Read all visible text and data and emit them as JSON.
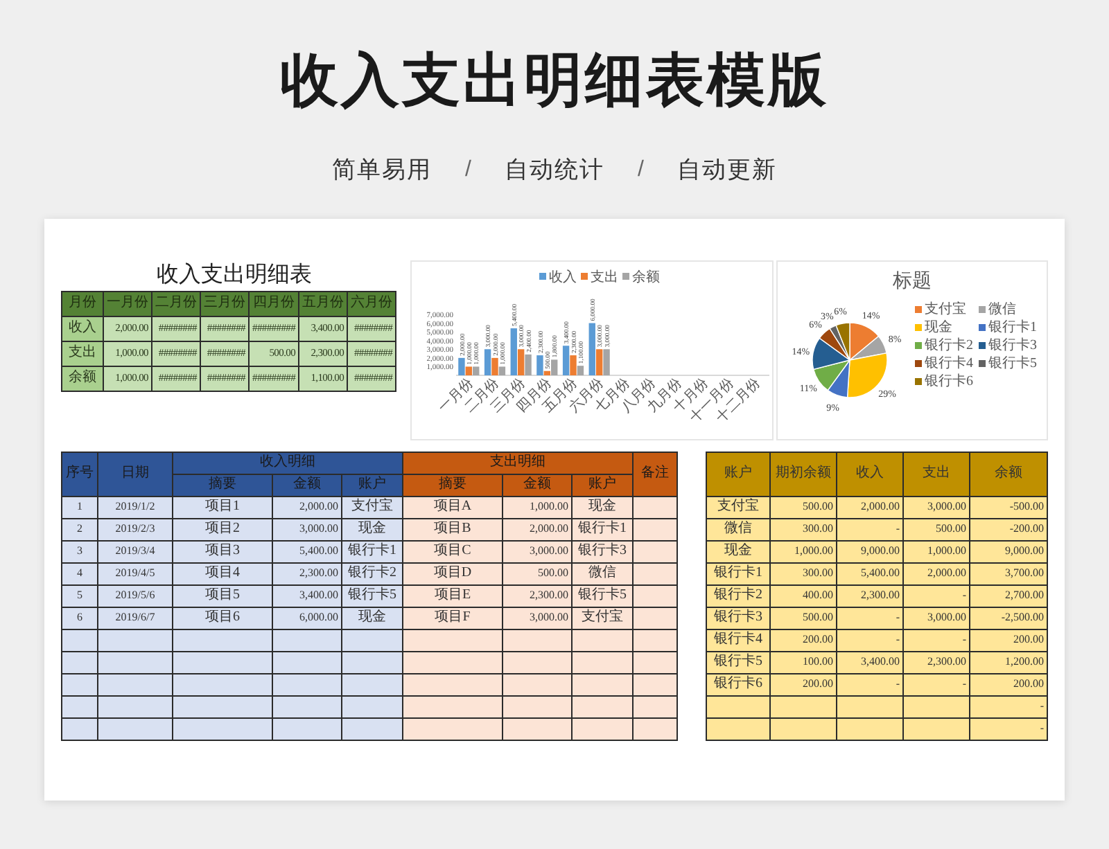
{
  "title": "收入支出明细表模版",
  "subtitle": [
    {
      "kind": "text",
      "text": "简单易用"
    },
    {
      "kind": "separator",
      "text": "/"
    },
    {
      "kind": "text",
      "text": "自动统计"
    },
    {
      "kind": "separator",
      "text": "/"
    },
    {
      "kind": "text",
      "text": "自动更新"
    }
  ],
  "summary": {
    "title": "收入支出明细表",
    "columns": [
      "月份",
      "一月份",
      "二月份",
      "三月份",
      "四月份",
      "五月份",
      "六月份"
    ],
    "rows": [
      [
        "收入",
        "2,000.00",
        "########",
        "########",
        "#########",
        "3,400.00",
        "########"
      ],
      [
        "支出",
        "1,000.00",
        "########",
        "########",
        "500.00",
        "2,300.00",
        "########"
      ],
      [
        "余额",
        "1,000.00",
        "########",
        "########",
        "#########",
        "1,100.00",
        "########"
      ]
    ]
  },
  "bar_chart": {
    "chart_data": {
      "type": "bar",
      "categories": [
        "一月份",
        "二月份",
        "三月份",
        "四月份",
        "五月份",
        "六月份",
        "七月份",
        "八月份",
        "九月份",
        "十月份",
        "十一月份",
        "十二月份"
      ],
      "series": [
        {
          "name": "收入",
          "color": "#5b9bd5",
          "values": [
            2000,
            3000,
            5400,
            2300,
            3400,
            6000,
            null,
            null,
            null,
            null,
            null,
            null
          ]
        },
        {
          "name": "支出",
          "color": "#ed7d31",
          "values": [
            1000,
            2000,
            3000,
            500,
            2300,
            3000,
            null,
            null,
            null,
            null,
            null,
            null
          ]
        },
        {
          "name": "余额",
          "color": "#a5a5a5",
          "values": [
            1000,
            1000,
            2400,
            1800,
            1100,
            3000,
            null,
            null,
            null,
            null,
            null,
            null
          ]
        }
      ],
      "ylim": [
        0,
        7000
      ],
      "yticks": [
        {
          "value": 1000,
          "label": "1,000.00"
        },
        {
          "value": 2000,
          "label": "2,000.00"
        },
        {
          "value": 3000,
          "label": "3,000.00"
        },
        {
          "value": 4000,
          "label": "4,000.00"
        },
        {
          "value": 5000,
          "label": "5,000.00"
        },
        {
          "value": 6000,
          "label": "6,000.00"
        },
        {
          "value": 7000,
          "label": "7,000.00"
        }
      ],
      "value_labels": [
        [
          "2,000.00",
          "3,000.00",
          "5,400.00",
          "2,300.00",
          "3,400.00",
          "6,000.00",
          null,
          null,
          null,
          null,
          null,
          null
        ],
        [
          "1,000.00",
          "2,000.00",
          "3,000.00",
          "500.00",
          "2,300.00",
          "3,000.00",
          null,
          null,
          null,
          null,
          null,
          null
        ],
        [
          "1,000.00",
          "1,000.00",
          "2,400.00",
          "1,800.00",
          "1,100.00",
          "3,000.00",
          null,
          null,
          null,
          null,
          null,
          null
        ]
      ],
      "legend": "top"
    }
  },
  "pie_chart": {
    "chart_data": {
      "type": "pie",
      "title": "标题",
      "categories": [
        "支付宝",
        "微信",
        "现金",
        "银行卡1",
        "银行卡2",
        "银行卡3",
        "银行卡4",
        "银行卡5",
        "银行卡6"
      ],
      "values": [
        14,
        8,
        29,
        9,
        11,
        14,
        6,
        3,
        6
      ],
      "value_labels": [
        "14%",
        "8%",
        "29%",
        "9%",
        "11%",
        "14%",
        "6%",
        "3%",
        "6%"
      ],
      "legend": "right"
    }
  },
  "details": {
    "index_header": "序号",
    "date_header": "日期",
    "income_header": "收入明细",
    "expense_header": "支出明细",
    "note_header": "备注",
    "income_columns": [
      "摘要",
      "金额",
      "账户"
    ],
    "expense_columns": [
      "摘要",
      "金额",
      "账户"
    ],
    "rows": [
      {
        "index": "1",
        "date": "2019/1/2",
        "income_item": "项目1",
        "income_amount": "2,000.00",
        "income_account": "支付宝",
        "expense_item": "项目A",
        "expense_amount": "1,000.00",
        "expense_account": "现金"
      },
      {
        "index": "2",
        "date": "2019/2/3",
        "income_item": "项目2",
        "income_amount": "3,000.00",
        "income_account": "现金",
        "expense_item": "项目B",
        "expense_amount": "2,000.00",
        "expense_account": "银行卡1"
      },
      {
        "index": "3",
        "date": "2019/3/4",
        "income_item": "项目3",
        "income_amount": "5,400.00",
        "income_account": "银行卡1",
        "expense_item": "项目C",
        "expense_amount": "3,000.00",
        "expense_account": "银行卡3"
      },
      {
        "index": "4",
        "date": "2019/4/5",
        "income_item": "项目4",
        "income_amount": "2,300.00",
        "income_account": "银行卡2",
        "expense_item": "项目D",
        "expense_amount": "500.00",
        "expense_account": "微信"
      },
      {
        "index": "5",
        "date": "2019/5/6",
        "income_item": "项目5",
        "income_amount": "3,400.00",
        "income_account": "银行卡5",
        "expense_item": "项目E",
        "expense_amount": "2,300.00",
        "expense_account": "银行卡5"
      },
      {
        "index": "6",
        "date": "2019/6/7",
        "income_item": "项目6",
        "income_amount": "6,000.00",
        "income_account": "现金",
        "expense_item": "项目F",
        "expense_amount": "3,000.00",
        "expense_account": "支付宝"
      }
    ]
  },
  "accounts": {
    "columns": [
      "账户",
      "期初余额",
      "收入",
      "支出",
      "余额"
    ],
    "rows": [
      [
        "支付宝",
        "500.00",
        "2,000.00",
        "3,000.00",
        "-500.00"
      ],
      [
        "微信",
        "300.00",
        "-",
        "500.00",
        "-200.00"
      ],
      [
        "现金",
        "1,000.00",
        "9,000.00",
        "1,000.00",
        "9,000.00"
      ],
      [
        "银行卡1",
        "300.00",
        "5,400.00",
        "2,000.00",
        "3,700.00"
      ],
      [
        "银行卡2",
        "400.00",
        "2,300.00",
        "-",
        "2,700.00"
      ],
      [
        "银行卡3",
        "500.00",
        "-",
        "3,000.00",
        "-2,500.00"
      ],
      [
        "银行卡4",
        "200.00",
        "-",
        "-",
        "200.00"
      ],
      [
        "银行卡5",
        "100.00",
        "3,400.00",
        "2,300.00",
        "1,200.00"
      ],
      [
        "银行卡6",
        "200.00",
        "-",
        "-",
        "200.00"
      ],
      [
        "",
        "",
        "",
        "",
        "-"
      ],
      [
        "",
        "",
        "",
        "",
        "-"
      ]
    ]
  }
}
